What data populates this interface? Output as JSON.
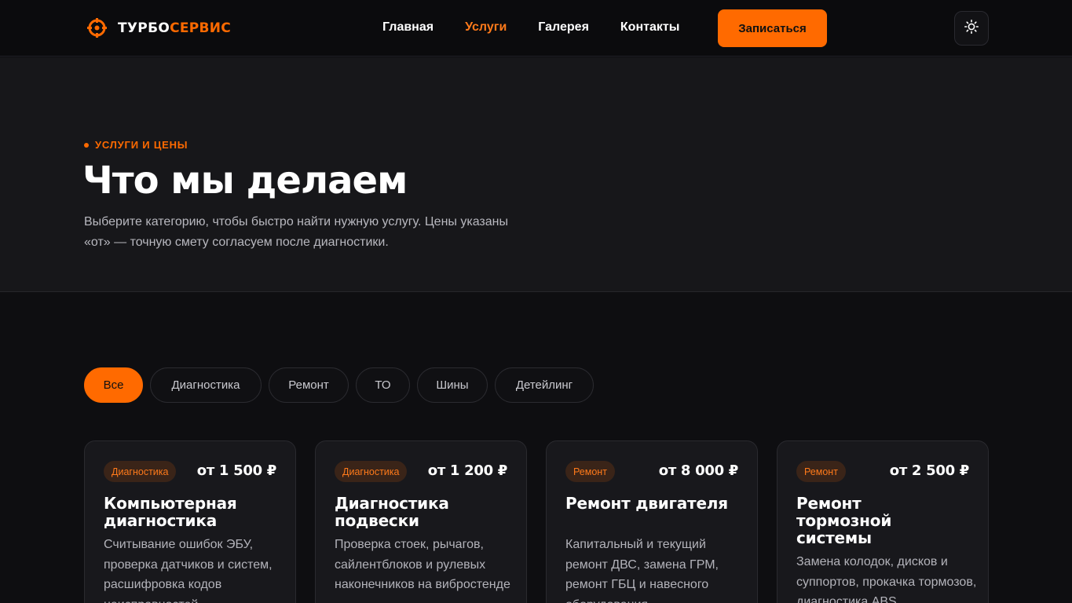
{
  "header": {
    "logo_part1": "ТУРБО",
    "logo_part2": "СЕРВИС",
    "nav": [
      "Главная",
      "Услуги",
      "Галерея",
      "Контакты"
    ],
    "active_nav": "Услуги",
    "cta_label": "Записаться",
    "theme_icon": "sun-icon"
  },
  "hero": {
    "eyebrow": "УСЛУГИ И ЦЕНЫ",
    "title": "Что мы делаем",
    "description": "Выберите категорию, чтобы быстро найти нужную услугу. Цены указаны «от» — точную смету согласуем после диагностики."
  },
  "filters": [
    "Все",
    "Диагностика",
    "Ремонт",
    "ТО",
    "Шины",
    "Детейлинг"
  ],
  "active_filter": "Все",
  "cards": [
    {
      "category": "Диагностика",
      "price": "от 1 500 ₽",
      "title": "Компьютерная диагностика",
      "description": "Считывание ошибок ЭБУ, проверка датчиков и систем, расшифровка кодов неисправностей"
    },
    {
      "category": "Диагностика",
      "price": "от 1 200 ₽",
      "title": "Диагностика подвески",
      "description": "Проверка стоек, рычагов, сайлентблоков и рулевых наконечников на вибростенде"
    },
    {
      "category": "Ремонт",
      "price": "от 8 000 ₽",
      "title": "Ремонт двигателя",
      "description": "Капитальный и текущий ремонт ДВС, замена ГРМ, ремонт ГБЦ и навесного оборудования"
    },
    {
      "category": "Ремонт",
      "price": "от 2 500 ₽",
      "title": "Ремонт тормозной системы",
      "description": "Замена колодок, дисков и суппортов, прокачка тормозов, диагностика ABS"
    }
  ],
  "colors": {
    "accent": "#ff6a00",
    "background": "#0e0e11",
    "hero_background": "#17171a",
    "card_background": "#18181c"
  }
}
